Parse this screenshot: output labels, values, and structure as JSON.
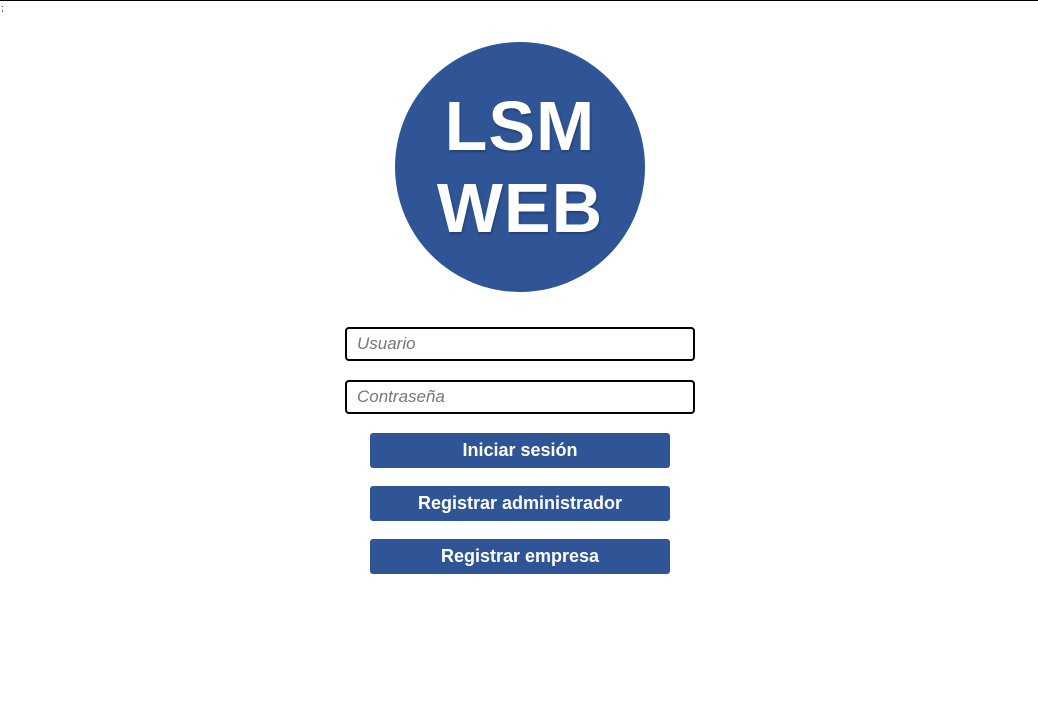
{
  "stray_glyph": ";",
  "logo": {
    "line1": "LSM",
    "line2": "WEB",
    "background_color": "#2f5597"
  },
  "login_form": {
    "username_placeholder": "Usuario",
    "username_value": "",
    "password_placeholder": "Contraseña",
    "password_value": ""
  },
  "buttons": {
    "login_label": "Iniciar sesión",
    "register_admin_label": "Registrar administrador",
    "register_company_label": "Registrar empresa",
    "color": "#2f5597"
  }
}
